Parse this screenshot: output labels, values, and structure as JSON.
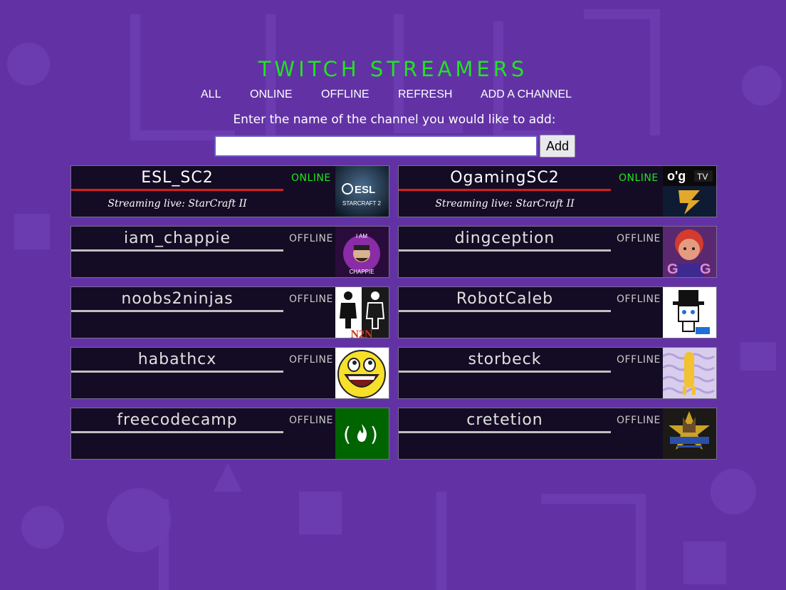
{
  "title": "TWITCH STREAMERS",
  "nav": {
    "all": "ALL",
    "online": "ONLINE",
    "offline": "OFFLINE",
    "refresh": "REFRESH",
    "add": "ADD A CHANNEL"
  },
  "add_channel": {
    "prompt": "Enter the name of the channel you would like to add:",
    "input_value": "",
    "button_label": "Add"
  },
  "channels": [
    {
      "name": "ESL_SC2",
      "status": "ONLINE",
      "stream": "Streaming live: StarCraft II",
      "logo": "esl-starcraft-logo"
    },
    {
      "name": "OgamingSC2",
      "status": "ONLINE",
      "stream": "Streaming live: StarCraft II",
      "logo": "ogtv-starcraft-logo"
    },
    {
      "name": "iam_chappie",
      "status": "OFFLINE",
      "stream": "",
      "logo": "chappie-logo"
    },
    {
      "name": "dingception",
      "status": "OFFLINE",
      "stream": "",
      "logo": "dingception-avatar"
    },
    {
      "name": "noobs2ninjas",
      "status": "OFFLINE",
      "stream": "",
      "logo": "n2n-logo"
    },
    {
      "name": "RobotCaleb",
      "status": "OFFLINE",
      "stream": "",
      "logo": "robotcaleb-avatar"
    },
    {
      "name": "habathcx",
      "status": "OFFLINE",
      "stream": "",
      "logo": "smiley-face-logo"
    },
    {
      "name": "storbeck",
      "status": "OFFLINE",
      "stream": "",
      "logo": "storbeck-avatar"
    },
    {
      "name": "freecodecamp",
      "status": "OFFLINE",
      "stream": "",
      "logo": "freecodecamp-logo"
    },
    {
      "name": "cretetion",
      "status": "OFFLINE",
      "stream": "",
      "logo": "cretetion-logo"
    }
  ],
  "colors": {
    "background": "#6232a5",
    "title": "#1ee61e",
    "online": "#1ee61e",
    "online_bar": "#d61f1f",
    "card_bg": "#140c24"
  }
}
